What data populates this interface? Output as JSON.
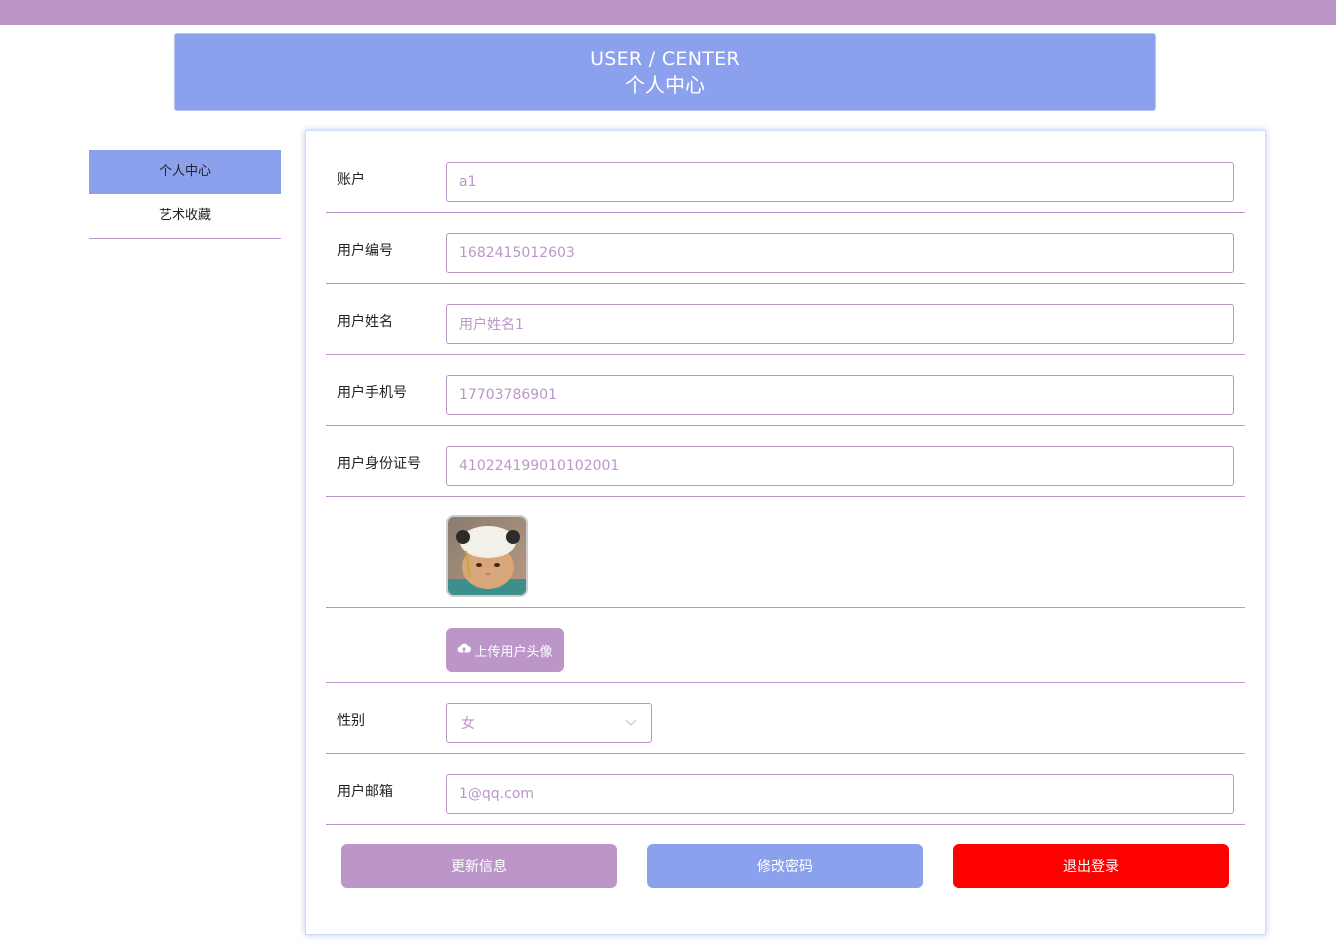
{
  "header": {
    "title_en": "USER / CENTER",
    "title_cn": "个人中心"
  },
  "sidebar": {
    "items": [
      {
        "label": "个人中心",
        "active": true
      },
      {
        "label": "艺术收藏",
        "active": false
      }
    ]
  },
  "form": {
    "account": {
      "label": "账户",
      "value": "a1"
    },
    "user_id": {
      "label": "用户编号",
      "value": "1682415012603"
    },
    "user_name": {
      "label": "用户姓名",
      "value": "用户姓名1"
    },
    "user_phone": {
      "label": "用户手机号",
      "value": "17703786901"
    },
    "user_id_card": {
      "label": "用户身份证号",
      "value": "410224199010102001"
    },
    "avatar": {
      "icon": "cat-photo"
    },
    "upload": {
      "label": "上传用户头像",
      "icon": "cloud-upload-icon"
    },
    "gender": {
      "label": "性别",
      "selected": "女"
    },
    "email": {
      "label": "用户邮箱",
      "value": "1@qq.com"
    }
  },
  "actions": {
    "update_label": "更新信息",
    "change_password_label": "修改密码",
    "logout_label": "退出登录"
  },
  "colors": {
    "primary_purple": "#bc96c8",
    "primary_blue": "#8ca1ee",
    "danger_red": "#ff0000"
  }
}
